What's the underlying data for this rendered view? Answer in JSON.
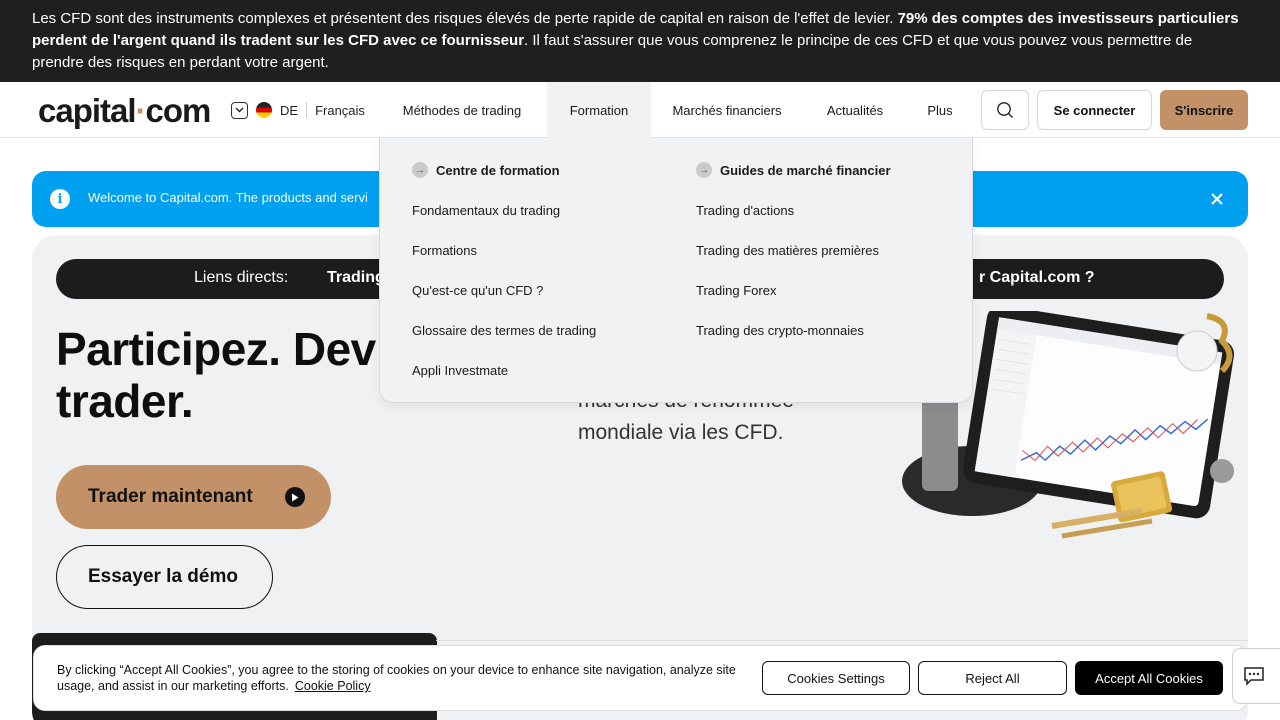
{
  "risk_banner": {
    "text_part1": "Les CFD sont des instruments complexes et présentent des risques élevés de perte rapide de capital en raison de l'effet de levier. ",
    "text_bold": "79% des comptes des investisseurs particuliers perdent de l'argent quand ils tradent sur les CFD avec ce fournisseur",
    "text_part2": ". Il faut s'assurer que vous comprenez le principe de ces CFD et que vous pouvez vous permettre de prendre des risques en perdant votre argent."
  },
  "header": {
    "logo_left": "capital",
    "logo_dot": "·",
    "logo_right": "com",
    "region_code": "DE",
    "language": "Français",
    "nav": [
      "Méthodes de trading",
      "Formation",
      "Marchés financiers",
      "Actualités",
      "Plus"
    ],
    "login": "Se connecter",
    "signup": "S'inscrire"
  },
  "welcome": {
    "text": "Welcome to Capital.com. The products and servi"
  },
  "dropdown": {
    "col1_heading": "Centre de formation",
    "col1_links": [
      "Fondamentaux du trading",
      "Formations",
      "Qu'est-ce qu'un CFD ?",
      "Glossaire des termes de trading",
      "Appli Investmate"
    ],
    "col2_heading": "Guides de marché financier",
    "col2_links": [
      "Trading d'actions",
      "Trading des matières premières",
      "Trading Forex",
      "Trading des crypto-monnaies"
    ]
  },
  "hero": {
    "quicklinks_label": "Liens directs:",
    "quicklink_a": "Trading",
    "quicklink_b": "r Capital.com ?",
    "headline_line1": "Participez. Dev",
    "headline_line2": "trader.",
    "subtext_line1": "marchés de renommée",
    "subtext_line2": "mondiale via les CFD.",
    "cta_trade": "Trader maintenant",
    "cta_demo": "Essayer la démo"
  },
  "cookie": {
    "text": "By clicking “Accept All Cookies”, you agree to the storing of cookies on your device to enhance site navigation, analyze site usage, and assist in our marketing efforts.",
    "policy_link": "Cookie Policy",
    "settings": "Cookies Settings",
    "reject": "Reject All",
    "accept": "Accept All Cookies"
  },
  "colors": {
    "brand_accent": "#c39167",
    "banner_bg": "#1f1f1f",
    "info_blue": "#00a0f0",
    "hero_bg": "#f0f1f3"
  }
}
